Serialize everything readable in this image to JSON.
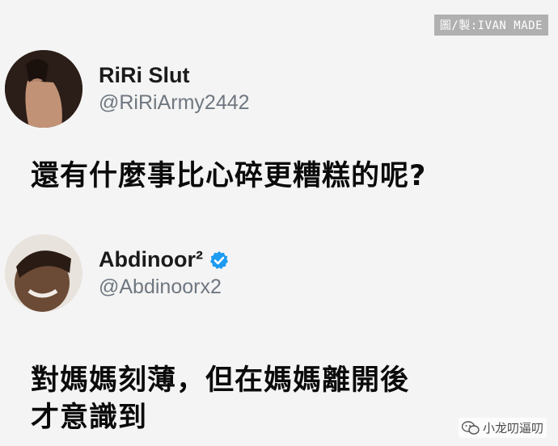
{
  "watermark_top": "圖/製:IVAN MADE",
  "post1": {
    "display_name": "RiRi Slut",
    "handle": "@RiRiArmy2442",
    "text": "還有什麼事比心碎更糟糕的呢?"
  },
  "post2": {
    "display_name": "Abdinoor²",
    "handle": "@Abdinoorx2",
    "verified": true,
    "text_line1": "對媽媽刻薄，但在媽媽離開後",
    "text_line2": "才意識到"
  },
  "watermark_bottom": {
    "icon": "wechat-icon",
    "text": "小龙叨逼叨"
  },
  "colors": {
    "background": "#f4f4f4",
    "handle_gray": "#6f7780",
    "verified_blue": "#1d9bf0"
  }
}
